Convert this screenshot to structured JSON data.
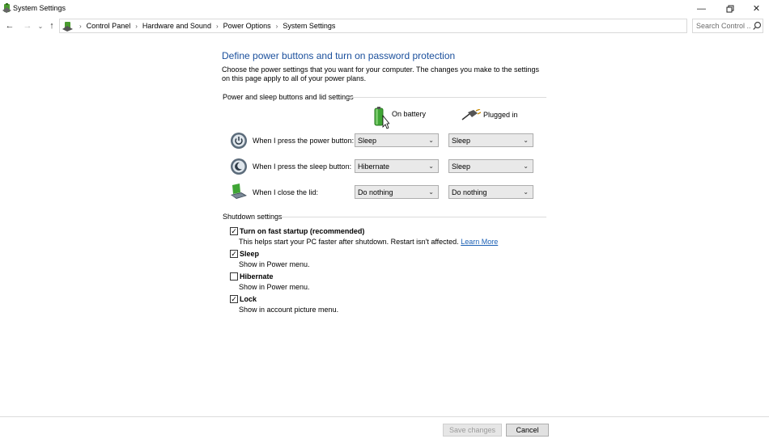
{
  "window": {
    "title": "System Settings",
    "icons": {
      "app": "power-options-icon",
      "minimize": "minimize-icon",
      "restore": "restore-icon",
      "close": "close-icon"
    }
  },
  "navigation": {
    "breadcrumbs": [
      "Control Panel",
      "Hardware and Sound",
      "Power Options",
      "System Settings"
    ],
    "search_placeholder": "Search Control ...",
    "icons": {
      "back": "back-arrow-icon",
      "forward": "forward-arrow-icon",
      "recent": "chevron-down-icon",
      "up": "up-arrow-icon",
      "refresh": "refresh-icon",
      "search": "search-icon"
    }
  },
  "page": {
    "heading": "Define power buttons and turn on password protection",
    "intro": "Choose the power settings that you want for your computer. The changes you make to the settings on this page apply to all of your power plans."
  },
  "power_section": {
    "title": "Power and sleep buttons and lid settings",
    "columns": {
      "battery": "On battery",
      "plugged": "Plugged in"
    },
    "rows": [
      {
        "label": "When I press the power button:",
        "battery": "Sleep",
        "plugged": "Sleep",
        "icon": "power-button-icon"
      },
      {
        "label": "When I press the sleep button:",
        "battery": "Hibernate",
        "plugged": "Sleep",
        "icon": "sleep-button-icon"
      },
      {
        "label": "When I close the lid:",
        "battery": "Do nothing",
        "plugged": "Do nothing",
        "icon": "laptop-lid-icon"
      }
    ]
  },
  "shutdown_section": {
    "title": "Shutdown settings",
    "items": [
      {
        "label": "Turn on fast startup (recommended)",
        "description": "This helps start your PC faster after shutdown. Restart isn't affected.",
        "link": "Learn More",
        "checked": true
      },
      {
        "label": "Sleep",
        "description": "Show in Power menu.",
        "checked": true
      },
      {
        "label": "Hibernate",
        "description": "Show in Power menu.",
        "checked": false
      },
      {
        "label": "Lock",
        "description": "Show in account picture menu.",
        "checked": true
      }
    ]
  },
  "footer": {
    "save_label": "Save changes",
    "cancel_label": "Cancel"
  },
  "colors": {
    "heading": "#1a4f9c",
    "link": "#1a5fb4",
    "disabled_text": "#9a9a9a"
  }
}
